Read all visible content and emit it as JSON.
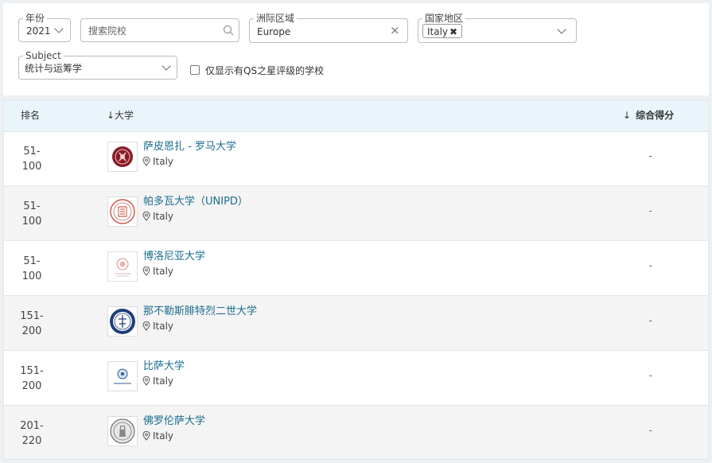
{
  "filters": {
    "year": {
      "label": "年份",
      "value": "2021"
    },
    "search": {
      "placeholder": "搜索院校"
    },
    "region": {
      "label": "洲际区域",
      "value": "Europe"
    },
    "country": {
      "label": "国家地区",
      "chip": "Italy"
    },
    "subject": {
      "label": "Subject",
      "value": "统计与运筹学"
    },
    "qs_stars_only": {
      "label": "仅显示有QS之星评级的学校",
      "checked": false
    }
  },
  "table": {
    "headers": {
      "rank": "排名",
      "university": "↓大学",
      "score": "综合得分"
    },
    "rows": [
      {
        "rank_line1": "51-",
        "rank_line2": "100",
        "name": "萨皮恩扎 - 罗马大学",
        "country": "Italy",
        "score": "-"
      },
      {
        "rank_line1": "51-",
        "rank_line2": "100",
        "name": "帕多瓦大学（UNIPD）",
        "country": "Italy",
        "score": "-"
      },
      {
        "rank_line1": "51-",
        "rank_line2": "100",
        "name": "博洛尼亚大学",
        "country": "Italy",
        "score": "-"
      },
      {
        "rank_line1": "151-",
        "rank_line2": "200",
        "name": "那不勒斯腓特烈二世大学",
        "country": "Italy",
        "score": "-"
      },
      {
        "rank_line1": "151-",
        "rank_line2": "200",
        "name": "比萨大学",
        "country": "Italy",
        "score": "-"
      },
      {
        "rank_line1": "201-",
        "rank_line2": "220",
        "name": "佛罗伦萨大学",
        "country": "Italy",
        "score": "-"
      }
    ]
  },
  "colors": {
    "link": "#1a6e8e",
    "header_bg": "#eaf5fb"
  }
}
